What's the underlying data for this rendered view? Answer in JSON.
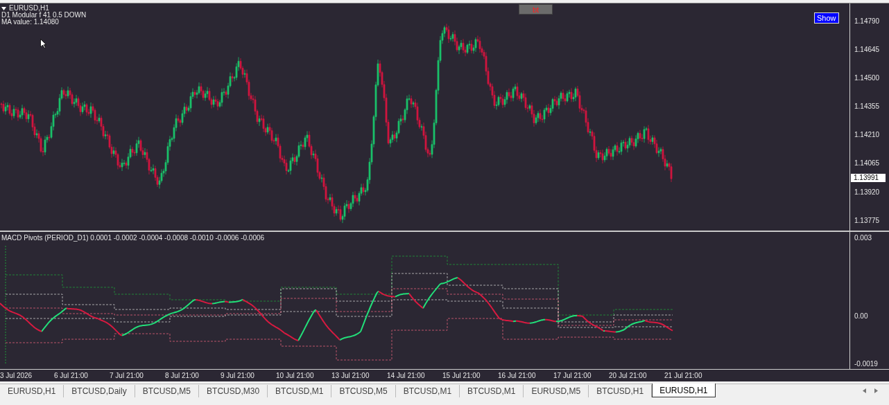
{
  "chart": {
    "symbol": "EURUSD,H1",
    "info_lines": [
      "D1 Modular f 41 0.5 DOWN",
      "MA value: 1.14080"
    ],
    "bt_button": "bt",
    "show_button": "Show",
    "price_ticks": [
      "1.14790",
      "1.14645",
      "1.14500",
      "1.14355",
      "1.14210",
      "1.14065",
      "1.13920",
      "1.13775"
    ],
    "current_price": "1.13991"
  },
  "indicator": {
    "title": "MACD Pivots (PERIOD_D1) 0.0001 -0.0002 -0.0004 -0.0008 -0.0010 -0.0006 -0.0006",
    "ticks": [
      "0.003",
      "0.00",
      "-0.0019"
    ]
  },
  "time_axis": [
    "3 Jul 2026",
    "6 Jul 21:00",
    "7 Jul 21:00",
    "8 Jul 21:00",
    "9 Jul 21:00",
    "10 Jul 21:00",
    "13 Jul 21:00",
    "14 Jul 21:00",
    "15 Jul 21:00",
    "16 Jul 21:00",
    "17 Jul 21:00",
    "20 Jul 21:00",
    "21 Jul 21:00"
  ],
  "tabs": [
    {
      "label": "EURUSD,H1",
      "selected": false
    },
    {
      "label": "BTCUSD,Daily",
      "selected": false
    },
    {
      "label": "BTCUSD,M5",
      "selected": false
    },
    {
      "label": "BTCUSD,M30",
      "selected": false
    },
    {
      "label": "BTCUSD,M1",
      "selected": false
    },
    {
      "label": "BTCUSD,M5",
      "selected": false
    },
    {
      "label": "BTCUSD,M1",
      "selected": false
    },
    {
      "label": "BTCUSD,M1",
      "selected": false
    },
    {
      "label": "EURUSD,M5",
      "selected": false
    },
    {
      "label": "BTCUSD,H1",
      "selected": false
    },
    {
      "label": "EURUSD,H1",
      "selected": true
    }
  ]
}
